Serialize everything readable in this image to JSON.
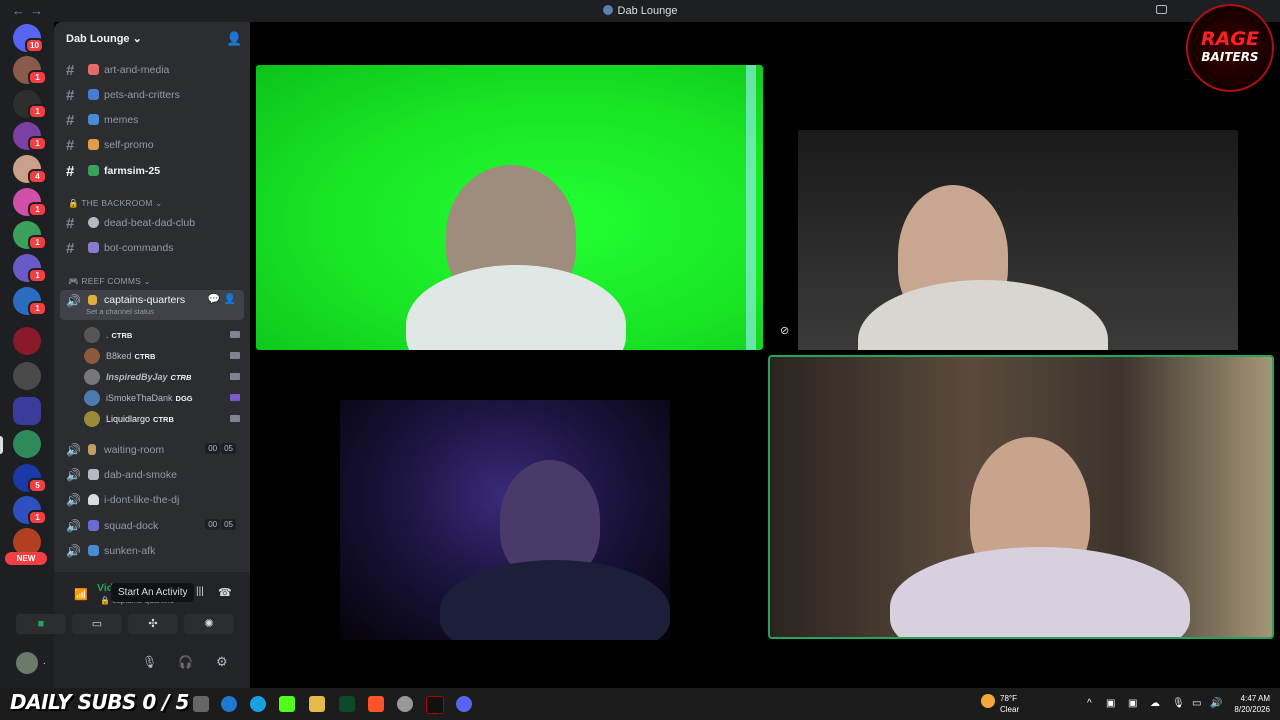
{
  "window": {
    "title": "Dab Lounge",
    "back": "←",
    "forward": "→"
  },
  "servers": {
    "badges": [
      "10",
      "1",
      "1",
      "1",
      "4",
      "1",
      "1",
      "1",
      "1",
      "1",
      "5",
      "1"
    ],
    "new_label": "NEW"
  },
  "sidebar": {
    "server_name": "Dab Lounge",
    "chevron": "⌄",
    "text_channels": [
      {
        "name": "art-and-media"
      },
      {
        "name": "pets-and-critters"
      },
      {
        "name": "memes"
      },
      {
        "name": "self-promo"
      },
      {
        "name": "farmsim-25"
      }
    ],
    "category_backroom": "THE BACKROOM",
    "backroom_channels": [
      {
        "name": "dead-beat-dad-club"
      },
      {
        "name": "bot-commands"
      }
    ],
    "category_reef": "REEF COMMS",
    "active_channel": {
      "name": "captains-quarters",
      "status": "Set a channel status"
    },
    "voice_users": [
      {
        "name": ".",
        "tag": "CTRB"
      },
      {
        "name": "B8ked",
        "tag": "CTRB"
      },
      {
        "name": "InspiredByJay",
        "tag": "CTRB"
      },
      {
        "name": "iSmokeThaDank",
        "tag": "DGG"
      },
      {
        "name": "Liquidlargo",
        "tag": "CTRB"
      }
    ],
    "voice_channels": [
      {
        "name": "waiting-room",
        "count_a": "00",
        "count_b": "05"
      },
      {
        "name": "dab-and-smoke"
      },
      {
        "name": "i-dont-like-the-dj"
      },
      {
        "name": "squad-dock",
        "count_a": "00",
        "count_b": "05"
      },
      {
        "name": "sunken-afk"
      }
    ]
  },
  "voice_panel": {
    "title": "Video Connected",
    "subtitle": "captains-quarters",
    "tooltip": "Start An Activity"
  },
  "user_panel": {
    "name": "."
  },
  "logo": {
    "line1": "RAGE",
    "line2": "BAITERS"
  },
  "taskbar": {
    "subs_text": "DAILY SUBS 0 / 5",
    "weather_temp": "78°F",
    "weather_desc": "Clear",
    "time": "4:47 AM",
    "date": "8/20/2026"
  },
  "colors": {
    "accent_green": "#23a55a",
    "badge_red": "#f23f43",
    "sidebar": "#2b2d31"
  }
}
